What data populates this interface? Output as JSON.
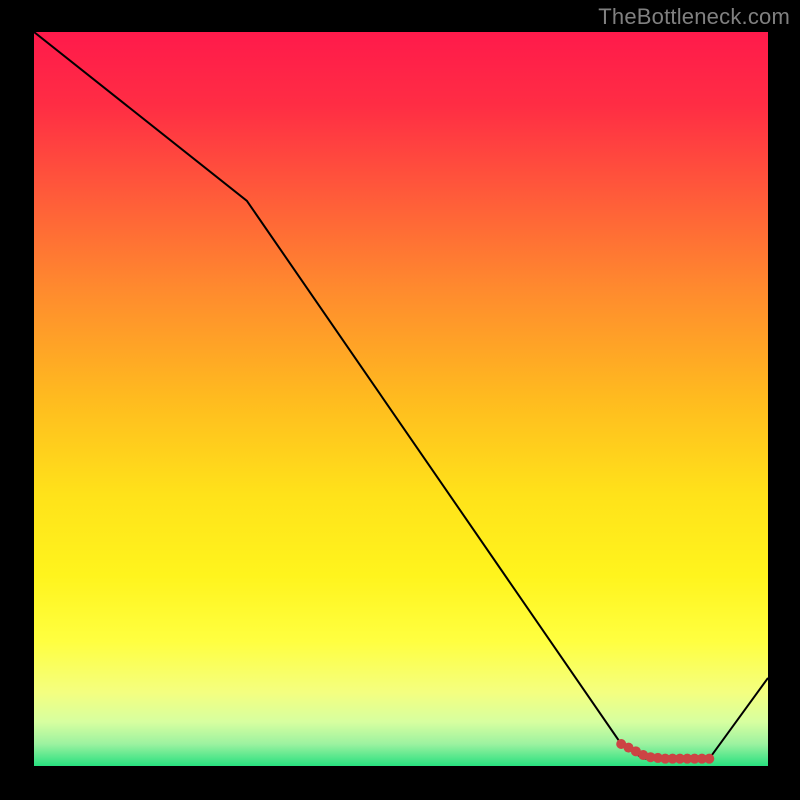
{
  "watermark": {
    "text": "TheBottleneck.com"
  },
  "chart_data": {
    "type": "line",
    "title": "",
    "xlabel": "",
    "ylabel": "",
    "xlim": [
      0,
      100
    ],
    "ylim": [
      0,
      100
    ],
    "grid": false,
    "legend": false,
    "series": [
      {
        "name": "black-line",
        "x": [
          0,
          29,
          80,
          83,
          92,
          100
        ],
        "values": [
          100,
          77,
          3,
          1,
          1,
          12
        ],
        "stroke": "#000000",
        "width": 2
      },
      {
        "name": "red-dots",
        "x": [
          80,
          81,
          82,
          83,
          84,
          85,
          86,
          87,
          88,
          89,
          90,
          91,
          92
        ],
        "values": [
          3,
          2.5,
          2,
          1.5,
          1.2,
          1.1,
          1.0,
          1.0,
          1.0,
          1.0,
          1.0,
          1.0,
          1.0
        ],
        "stroke": "#cc4444",
        "marker": "dot",
        "marker_radius": 5
      }
    ],
    "background": {
      "type": "vertical-gradient",
      "stops": [
        {
          "t": 0.0,
          "color": "#ff1a4b"
        },
        {
          "t": 0.1,
          "color": "#ff2d44"
        },
        {
          "t": 0.22,
          "color": "#ff5a3a"
        },
        {
          "t": 0.35,
          "color": "#ff8a2e"
        },
        {
          "t": 0.5,
          "color": "#ffbb1f"
        },
        {
          "t": 0.63,
          "color": "#ffe21a"
        },
        {
          "t": 0.74,
          "color": "#fff41d"
        },
        {
          "t": 0.83,
          "color": "#ffff40"
        },
        {
          "t": 0.9,
          "color": "#f4ff80"
        },
        {
          "t": 0.94,
          "color": "#d7ffa0"
        },
        {
          "t": 0.97,
          "color": "#9cf2a0"
        },
        {
          "t": 1.0,
          "color": "#28e07f"
        }
      ]
    }
  }
}
